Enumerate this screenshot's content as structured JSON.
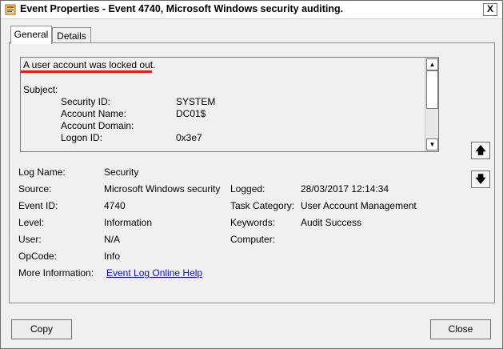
{
  "window": {
    "title": "Event Properties - Event 4740, Microsoft Windows security auditing.",
    "close_glyph": "X"
  },
  "tabs": [
    {
      "label": "General",
      "selected": true
    },
    {
      "label": "Details",
      "selected": false
    }
  ],
  "description": {
    "headline": "A user account was locked out.",
    "subject_label": "Subject:",
    "fields": [
      {
        "label": "Security ID:",
        "value": "SYSTEM"
      },
      {
        "label": "Account Name:",
        "value": "DC01$"
      },
      {
        "label": "Account Domain:",
        "value": ""
      },
      {
        "label": "Logon ID:",
        "value": "0x3e7"
      }
    ]
  },
  "details": {
    "log_name": {
      "label": "Log Name:",
      "value": "Security"
    },
    "source": {
      "label": "Source:",
      "value": "Microsoft Windows security"
    },
    "logged": {
      "label": "Logged:",
      "value": "28/03/2017 12:14:34"
    },
    "event_id": {
      "label": "Event ID:",
      "value": "4740"
    },
    "task_category": {
      "label": "Task Category:",
      "value": "User Account Management"
    },
    "level": {
      "label": "Level:",
      "value": "Information"
    },
    "keywords": {
      "label": "Keywords:",
      "value": "Audit Success"
    },
    "user": {
      "label": "User:",
      "value": "N/A"
    },
    "computer": {
      "label": "Computer:",
      "value": ""
    },
    "opcode": {
      "label": "OpCode:",
      "value": "Info"
    },
    "more_info": {
      "label": "More Information:",
      "link": "Event Log Online Help"
    }
  },
  "buttons": {
    "copy": "Copy",
    "close": "Close"
  },
  "colors": {
    "highlight_underline": "#e81a1a",
    "link": "#0a0cd6"
  }
}
